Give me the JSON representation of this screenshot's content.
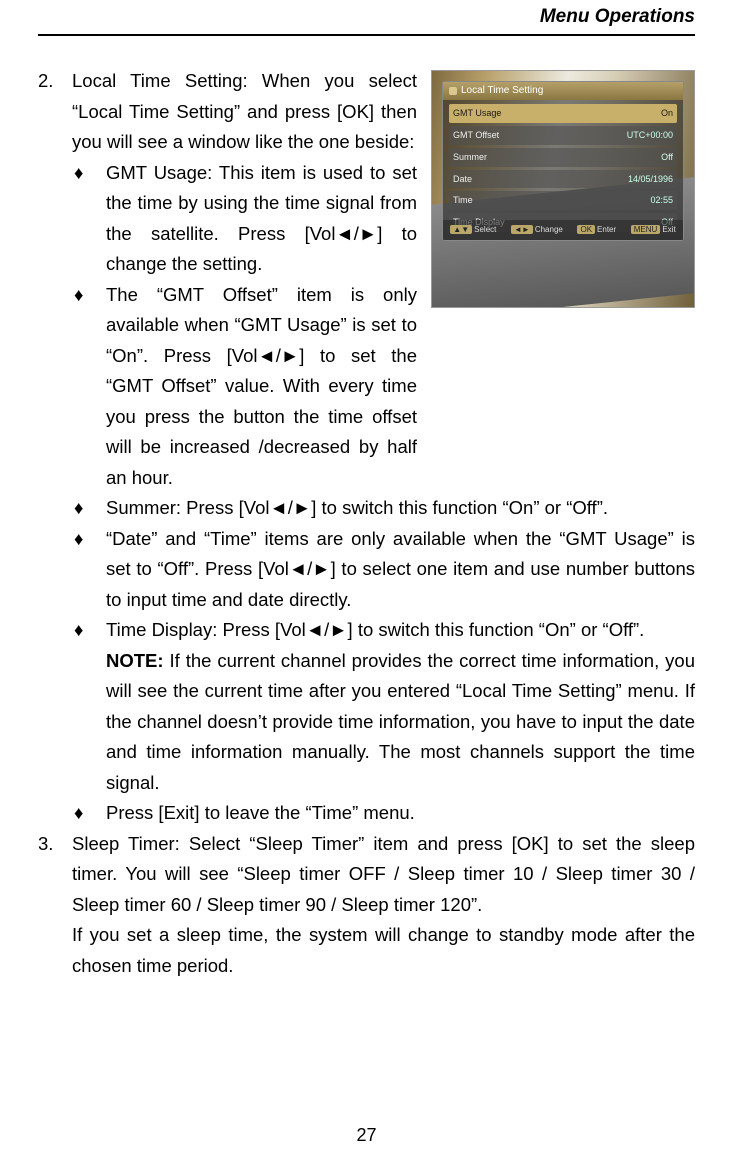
{
  "header": {
    "title": "Menu Operations"
  },
  "fig": {
    "dialog_title": "Local Time Setting",
    "rows": [
      {
        "label": "GMT Usage",
        "value": "On",
        "selected": true
      },
      {
        "label": "GMT Offset",
        "value": "UTC+00:00",
        "selected": false
      },
      {
        "label": "Summer",
        "value": "Off",
        "selected": false
      },
      {
        "label": "Date",
        "value": "14/05/1996",
        "selected": false
      },
      {
        "label": "Time",
        "value": "02:55",
        "selected": false
      },
      {
        "label": "Time Display",
        "value": "Off",
        "selected": false
      }
    ],
    "footer": [
      {
        "key": "▲▼",
        "label": "Select"
      },
      {
        "key": "◄►",
        "label": "Change"
      },
      {
        "key": "OK",
        "label": "Enter"
      },
      {
        "key": "MENU",
        "label": "Exit"
      }
    ]
  },
  "items": {
    "item2": {
      "num": "2.",
      "intro": "Local Time Setting: When you select “Local Time Setting” and press [OK] then you will see a window like the one beside:",
      "bullets": {
        "b1": "GMT Usage: This item is used to set the time by using the time signal from the satellite. Press [Vol◄/►] to change the setting.",
        "b2": "The “GMT Offset” item is only available when “GMT Usage” is set to “On”. Press [Vol◄/►] to set the “GMT Offset” value. With every time you press the button the time offset will be increased /decreased by half an hour.",
        "b3": "Summer: Press [Vol◄/►] to switch this function “On” or “Off”.",
        "b4": "“Date” and “Time” items are only available when the “GMT Usage” is set to “Off”. Press [Vol◄/►] to select one item and use number buttons to input time and date directly.",
        "b5_head": "Time Display: Press [Vol◄/►] to switch this function “On” or “Off”.",
        "b5_note_label": "NOTE:",
        "b5_note": " If the current channel provides the correct time information, you will see the current time after you entered “Local Time Setting” menu. If the channel doesn’t provide time information, you have to input the date and time information manually. The most channels support the time signal.",
        "b6": "Press [Exit] to leave the “Time” menu."
      }
    },
    "item3": {
      "num": "3.",
      "para1": "Sleep Timer: Select “Sleep Timer” item and press [OK] to set the sleep timer. You will see “Sleep timer OFF / Sleep timer 10 / Sleep timer 30 / Sleep timer 60 / Sleep timer 90 / Sleep timer 120”.",
      "para2": "If you set a sleep time, the system will change to standby mode after the chosen time period."
    }
  },
  "page_number": "27",
  "glyphs": {
    "diamond": "♦"
  }
}
